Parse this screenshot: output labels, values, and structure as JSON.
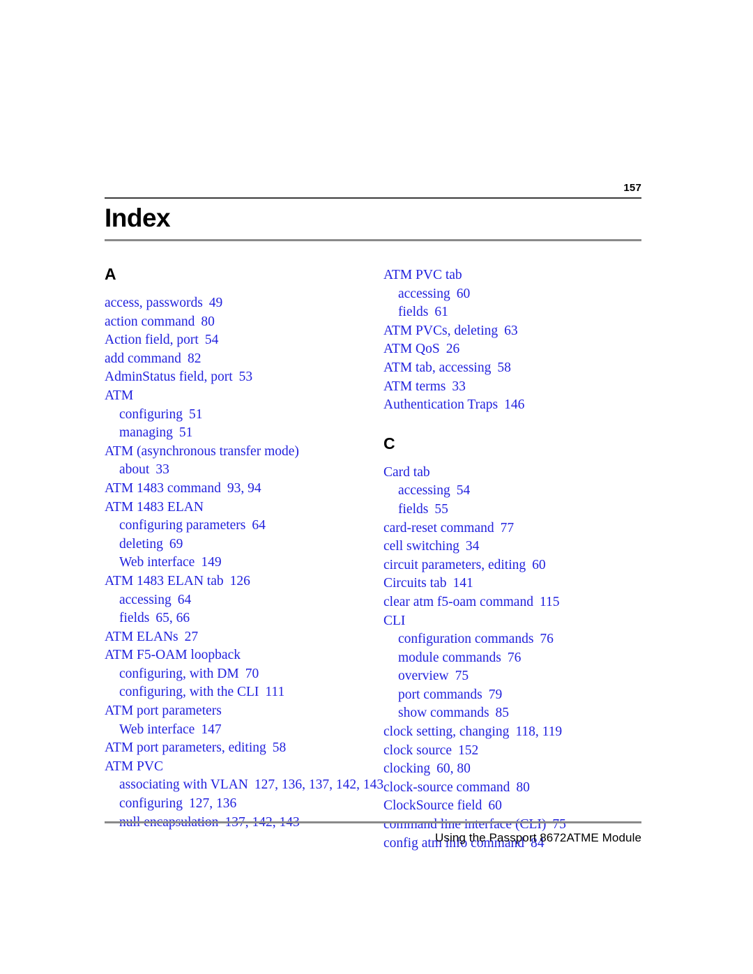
{
  "document": {
    "page_number": "157",
    "title": "Index",
    "footer": "Using the Passport 8672ATME Module",
    "link_color": "#2222dd",
    "heading_color": "#000000",
    "rule_color_thin": "#3a3a3a",
    "rule_color_thick": "#8a8a8a"
  },
  "columns": {
    "left": {
      "sections": [
        {
          "letter": "A",
          "entries": [
            {
              "level": "main",
              "text": "access, passwords",
              "pages": "49"
            },
            {
              "level": "main",
              "text": "action command",
              "pages": "80"
            },
            {
              "level": "main",
              "text": "Action field, port",
              "pages": "54"
            },
            {
              "level": "main",
              "text": "add command",
              "pages": "82"
            },
            {
              "level": "main",
              "text": "AdminStatus field, port",
              "pages": "53"
            },
            {
              "level": "main",
              "text": "ATM",
              "pages": ""
            },
            {
              "level": "sub",
              "text": "configuring",
              "pages": "51"
            },
            {
              "level": "sub",
              "text": "managing",
              "pages": "51"
            },
            {
              "level": "main",
              "text": "ATM (asynchronous transfer mode)",
              "pages": ""
            },
            {
              "level": "sub",
              "text": "about",
              "pages": "33"
            },
            {
              "level": "main",
              "text": "ATM 1483 command",
              "pages": "93, 94"
            },
            {
              "level": "main",
              "text": "ATM 1483 ELAN",
              "pages": ""
            },
            {
              "level": "sub",
              "text": "configuring parameters",
              "pages": "64"
            },
            {
              "level": "sub",
              "text": "deleting",
              "pages": "69"
            },
            {
              "level": "sub",
              "text": "Web interface",
              "pages": "149"
            },
            {
              "level": "main",
              "text": "ATM 1483 ELAN tab",
              "pages": "126"
            },
            {
              "level": "sub",
              "text": "accessing",
              "pages": "64"
            },
            {
              "level": "sub",
              "text": "fields",
              "pages": "65, 66"
            },
            {
              "level": "main",
              "text": "ATM ELANs",
              "pages": "27"
            },
            {
              "level": "main",
              "text": "ATM F5-OAM loopback",
              "pages": ""
            },
            {
              "level": "sub",
              "text": "configuring, with DM",
              "pages": "70"
            },
            {
              "level": "sub",
              "text": "configuring, with the CLI",
              "pages": "111"
            },
            {
              "level": "main",
              "text": "ATM port parameters",
              "pages": ""
            },
            {
              "level": "sub",
              "text": "Web interface",
              "pages": "147"
            },
            {
              "level": "main",
              "text": "ATM port parameters, editing",
              "pages": "58"
            },
            {
              "level": "main",
              "text": "ATM PVC",
              "pages": ""
            },
            {
              "level": "sub",
              "text": "associating with VLAN",
              "pages": "127, 136, 137, 142, 143"
            },
            {
              "level": "sub",
              "text": "configuring",
              "pages": "127, 136"
            },
            {
              "level": "sub",
              "text": "null encapsulation",
              "pages": "137, 142, 143"
            }
          ]
        }
      ]
    },
    "right": {
      "sections": [
        {
          "letter": "",
          "entries": [
            {
              "level": "main",
              "text": "ATM PVC tab",
              "pages": ""
            },
            {
              "level": "sub",
              "text": "accessing",
              "pages": "60"
            },
            {
              "level": "sub",
              "text": "fields",
              "pages": "61"
            },
            {
              "level": "main",
              "text": "ATM PVCs, deleting",
              "pages": "63"
            },
            {
              "level": "main",
              "text": "ATM QoS",
              "pages": "26"
            },
            {
              "level": "main",
              "text": "ATM tab, accessing",
              "pages": "58"
            },
            {
              "level": "main",
              "text": "ATM terms",
              "pages": "33"
            },
            {
              "level": "main",
              "text": "Authentication Traps",
              "pages": "146"
            }
          ]
        },
        {
          "letter": "C",
          "entries": [
            {
              "level": "main",
              "text": "Card tab",
              "pages": ""
            },
            {
              "level": "sub",
              "text": "accessing",
              "pages": "54"
            },
            {
              "level": "sub",
              "text": "fields",
              "pages": "55"
            },
            {
              "level": "main",
              "text": "card-reset command",
              "pages": "77"
            },
            {
              "level": "main",
              "text": "cell switching",
              "pages": "34"
            },
            {
              "level": "main",
              "text": "circuit parameters, editing",
              "pages": "60"
            },
            {
              "level": "main",
              "text": "Circuits tab",
              "pages": "141"
            },
            {
              "level": "main",
              "text": "clear atm f5-oam command",
              "pages": "115"
            },
            {
              "level": "main",
              "text": "CLI",
              "pages": ""
            },
            {
              "level": "sub",
              "text": "configuration commands",
              "pages": "76"
            },
            {
              "level": "sub",
              "text": "module commands",
              "pages": "76"
            },
            {
              "level": "sub",
              "text": "overview",
              "pages": "75"
            },
            {
              "level": "sub",
              "text": "port commands",
              "pages": "79"
            },
            {
              "level": "sub",
              "text": "show commands",
              "pages": "85"
            },
            {
              "level": "main",
              "text": "clock setting, changing",
              "pages": "118, 119"
            },
            {
              "level": "main",
              "text": "clock source",
              "pages": "152"
            },
            {
              "level": "main",
              "text": "clocking",
              "pages": "60, 80"
            },
            {
              "level": "main",
              "text": "clock-source command",
              "pages": "80"
            },
            {
              "level": "main",
              "text": "ClockSource field",
              "pages": "60"
            },
            {
              "level": "main",
              "text": "command line interface (CLI)",
              "pages": "75"
            },
            {
              "level": "main",
              "text": "config atm info command",
              "pages": "84"
            }
          ]
        }
      ]
    }
  }
}
